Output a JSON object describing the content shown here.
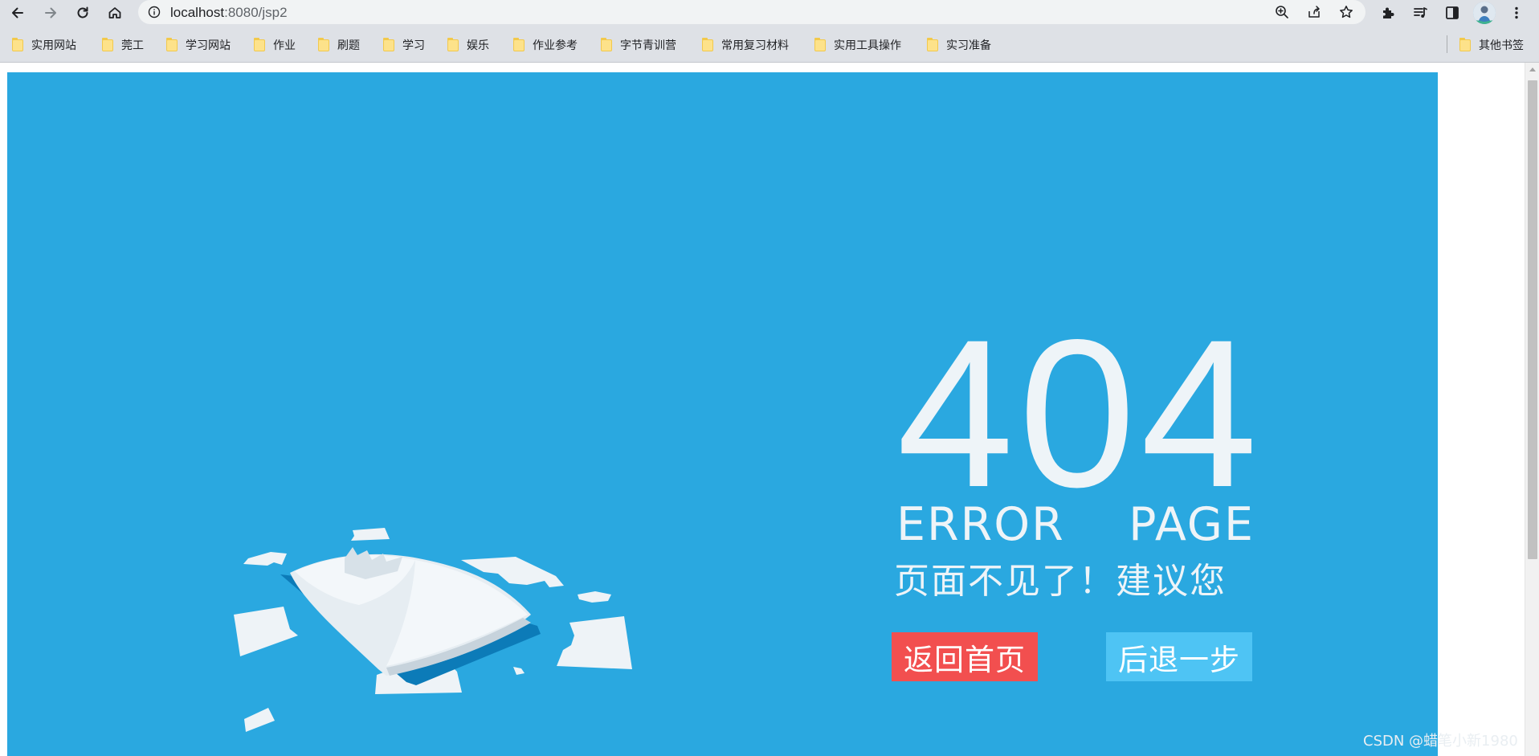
{
  "browser": {
    "url_host": "localhost",
    "url_rest": ":8080/jsp2",
    "icons": {
      "back": "arrow-left-icon",
      "forward": "arrow-right-icon",
      "reload": "reload-icon",
      "home": "home-icon",
      "site_info": "info-icon",
      "zoom": "zoom-icon",
      "share": "share-icon",
      "bookmark": "star-icon",
      "extensions": "puzzle-icon",
      "media": "media-queue-icon",
      "side_panel": "side-panel-icon",
      "menu": "kebab-menu-icon"
    }
  },
  "bookmarks": {
    "items": [
      {
        "label": "实用网站"
      },
      {
        "label": "莞工"
      },
      {
        "label": "学习网站"
      },
      {
        "label": "作业"
      },
      {
        "label": "刷题"
      },
      {
        "label": "学习"
      },
      {
        "label": "娱乐"
      },
      {
        "label": "作业参考"
      },
      {
        "label": "字节青训营"
      },
      {
        "label": "常用复习材料"
      },
      {
        "label": "实用工具操作"
      },
      {
        "label": "实习准备"
      }
    ],
    "other": "其他书签"
  },
  "page": {
    "code": "404",
    "title_word1": "ERROR",
    "title_word2": "PAGE",
    "subtitle": "页面不见了！建议您",
    "home_button": "返回首页",
    "back_button": "后退一步",
    "illustration": "torn-book-illustration",
    "colors": {
      "background": "#2aa8e0",
      "text": "#eef4f8",
      "home_button": "#f24f4f",
      "back_button": "#4ec4f4"
    }
  },
  "watermark": "CSDN @蜡笔小新1980"
}
